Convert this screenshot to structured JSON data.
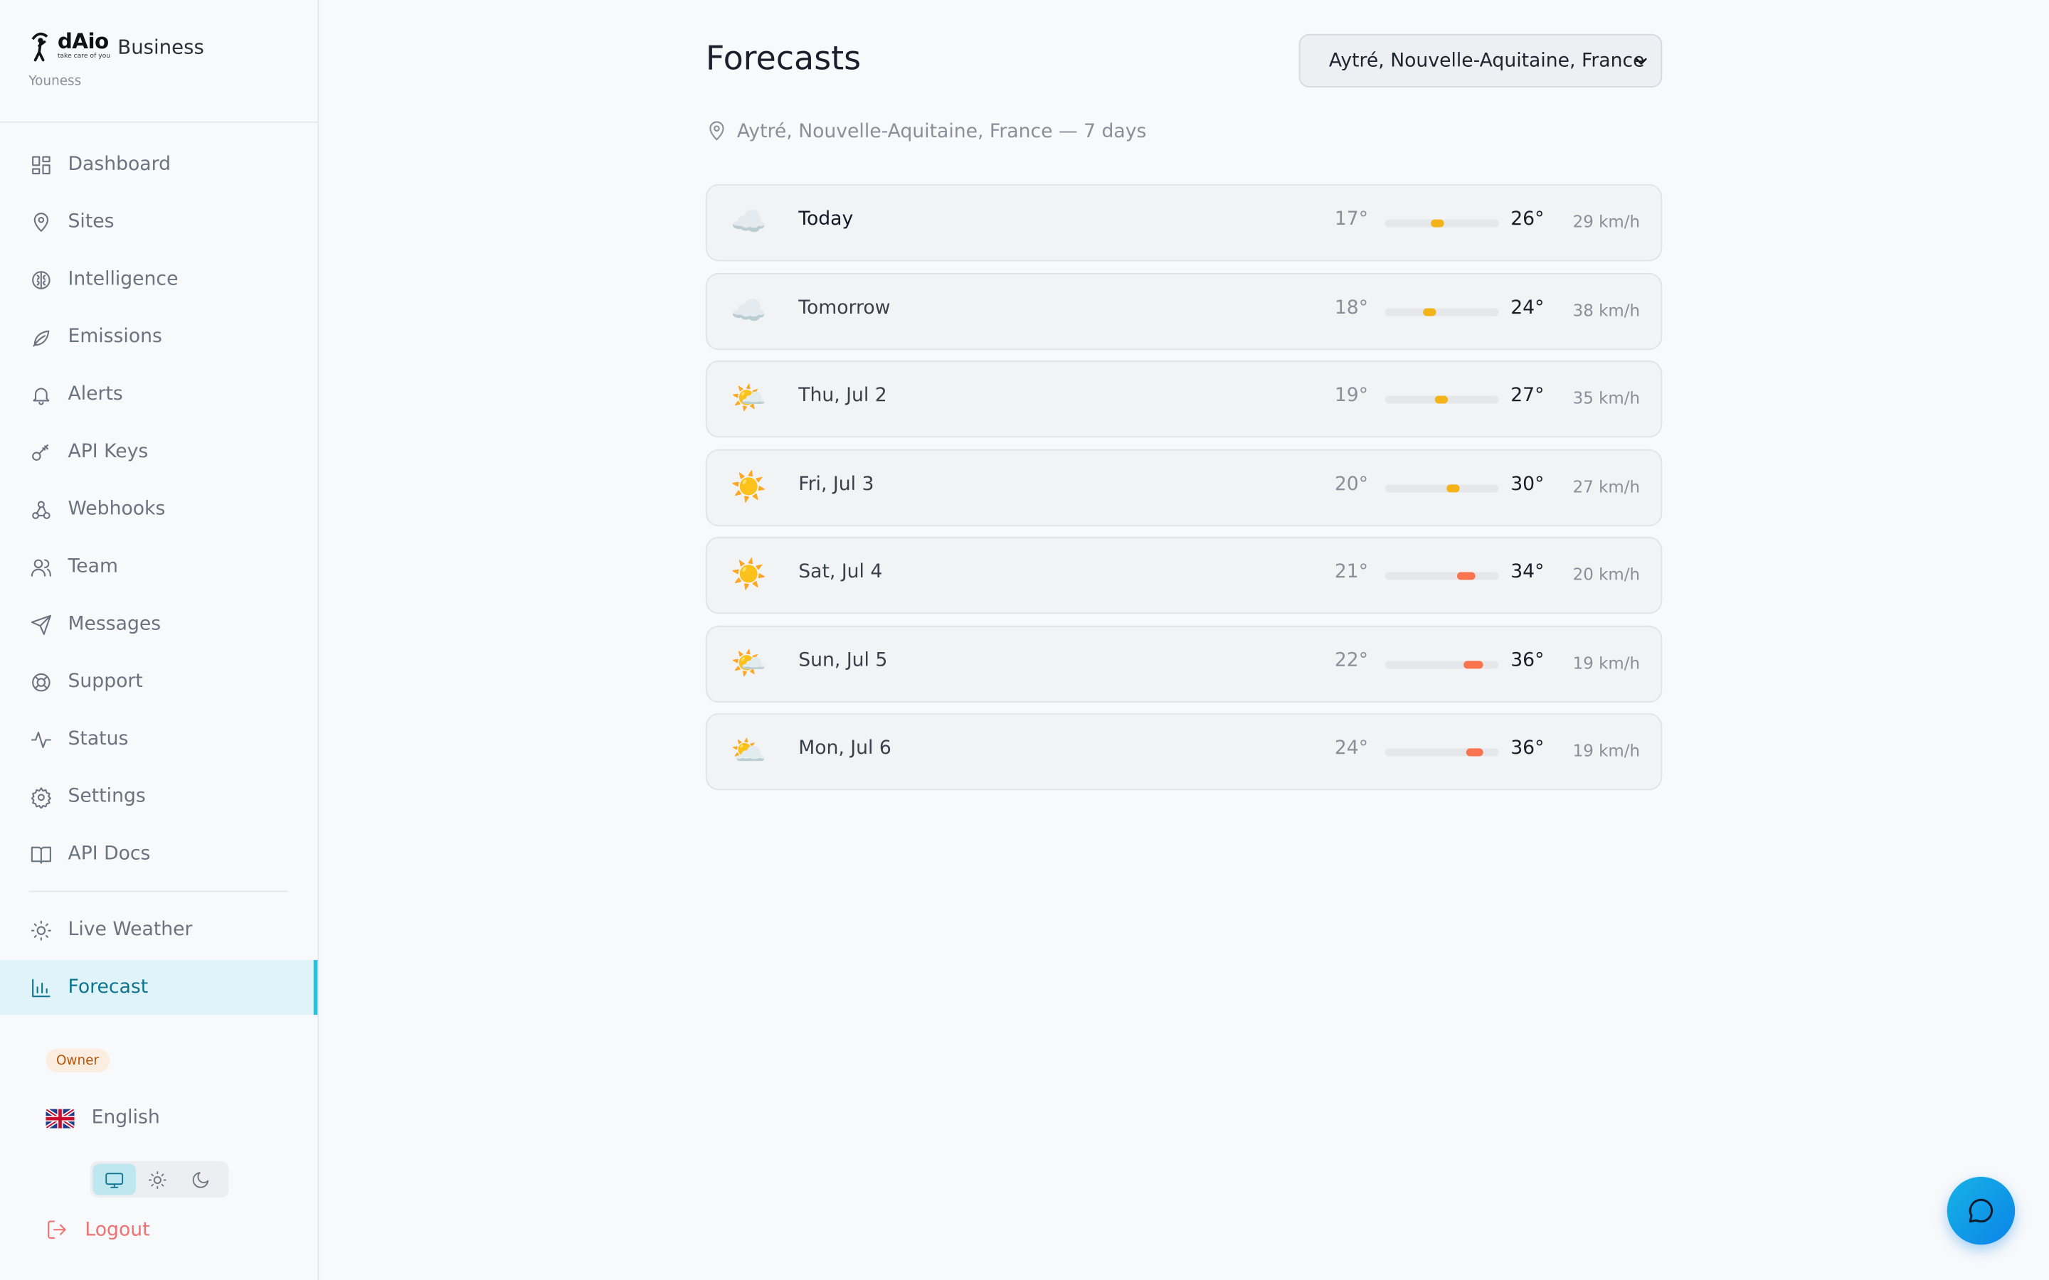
{
  "brand": {
    "logo_text": "dAio",
    "logo_tagline": "take care of you",
    "name": "Business",
    "user": "Youness"
  },
  "sidebar": {
    "items": [
      {
        "label": "Dashboard",
        "icon": "dashboard-icon"
      },
      {
        "label": "Sites",
        "icon": "map-pin-icon"
      },
      {
        "label": "Intelligence",
        "icon": "brain-icon"
      },
      {
        "label": "Emissions",
        "icon": "leaf-icon"
      },
      {
        "label": "Alerts",
        "icon": "bell-icon"
      },
      {
        "label": "API Keys",
        "icon": "key-icon"
      },
      {
        "label": "Webhooks",
        "icon": "webhook-icon"
      },
      {
        "label": "Team",
        "icon": "users-icon"
      },
      {
        "label": "Messages",
        "icon": "send-icon"
      },
      {
        "label": "Support",
        "icon": "lifebuoy-icon"
      },
      {
        "label": "Status",
        "icon": "activity-icon"
      },
      {
        "label": "Settings",
        "icon": "gear-icon"
      },
      {
        "label": "API Docs",
        "icon": "book-icon"
      }
    ],
    "secondary_items": [
      {
        "label": "Live Weather",
        "icon": "sun-icon"
      },
      {
        "label": "Forecast",
        "icon": "bar-chart-icon",
        "active": true
      }
    ],
    "role_badge": "Owner",
    "language": "English",
    "logout": "Logout",
    "theme_options": [
      "system",
      "light",
      "dark"
    ],
    "active_theme": "system"
  },
  "main": {
    "title": "Forecasts",
    "location_select": "Aytré, Nouvelle-Aquitaine, France",
    "subtitle": "Aytré, Nouvelle-Aquitaine, France — 7 days",
    "forecast": [
      {
        "day": "Today",
        "icon": "☁️",
        "low": 17,
        "low_text": "17°",
        "high": 26,
        "high_text": "26°",
        "wind": "29 km/h",
        "bar_color": "#f2b418"
      },
      {
        "day": "Tomorrow",
        "icon": "☁️",
        "low": 18,
        "low_text": "18°",
        "high": 24,
        "high_text": "24°",
        "wind": "38 km/h",
        "bar_color": "#f2b418"
      },
      {
        "day": "Thu, Jul 2",
        "icon": "🌤️",
        "low": 19,
        "low_text": "19°",
        "high": 27,
        "high_text": "27°",
        "wind": "35 km/h",
        "bar_color": "#f2b418"
      },
      {
        "day": "Fri, Jul 3",
        "icon": "☀️",
        "low": 20,
        "low_text": "20°",
        "high": 30,
        "high_text": "30°",
        "wind": "27 km/h",
        "bar_color": "#f2b418"
      },
      {
        "day": "Sat, Jul 4",
        "icon": "☀️",
        "low": 21,
        "low_text": "21°",
        "high": 34,
        "high_text": "34°",
        "wind": "20 km/h",
        "bar_color": "#f9744f"
      },
      {
        "day": "Sun, Jul 5",
        "icon": "🌤️",
        "low": 22,
        "low_text": "22°",
        "high": 36,
        "high_text": "36°",
        "wind": "19 km/h",
        "bar_color": "#f9744f"
      },
      {
        "day": "Mon, Jul 6",
        "icon": "⛅",
        "low": 24,
        "low_text": "24°",
        "high": 36,
        "high_text": "36°",
        "wind": "19 km/h",
        "bar_color": "#f9744f"
      }
    ]
  },
  "colors": {
    "accent": "#22c5e0",
    "active_bg": "#dff3f8",
    "danger": "#f07171"
  }
}
